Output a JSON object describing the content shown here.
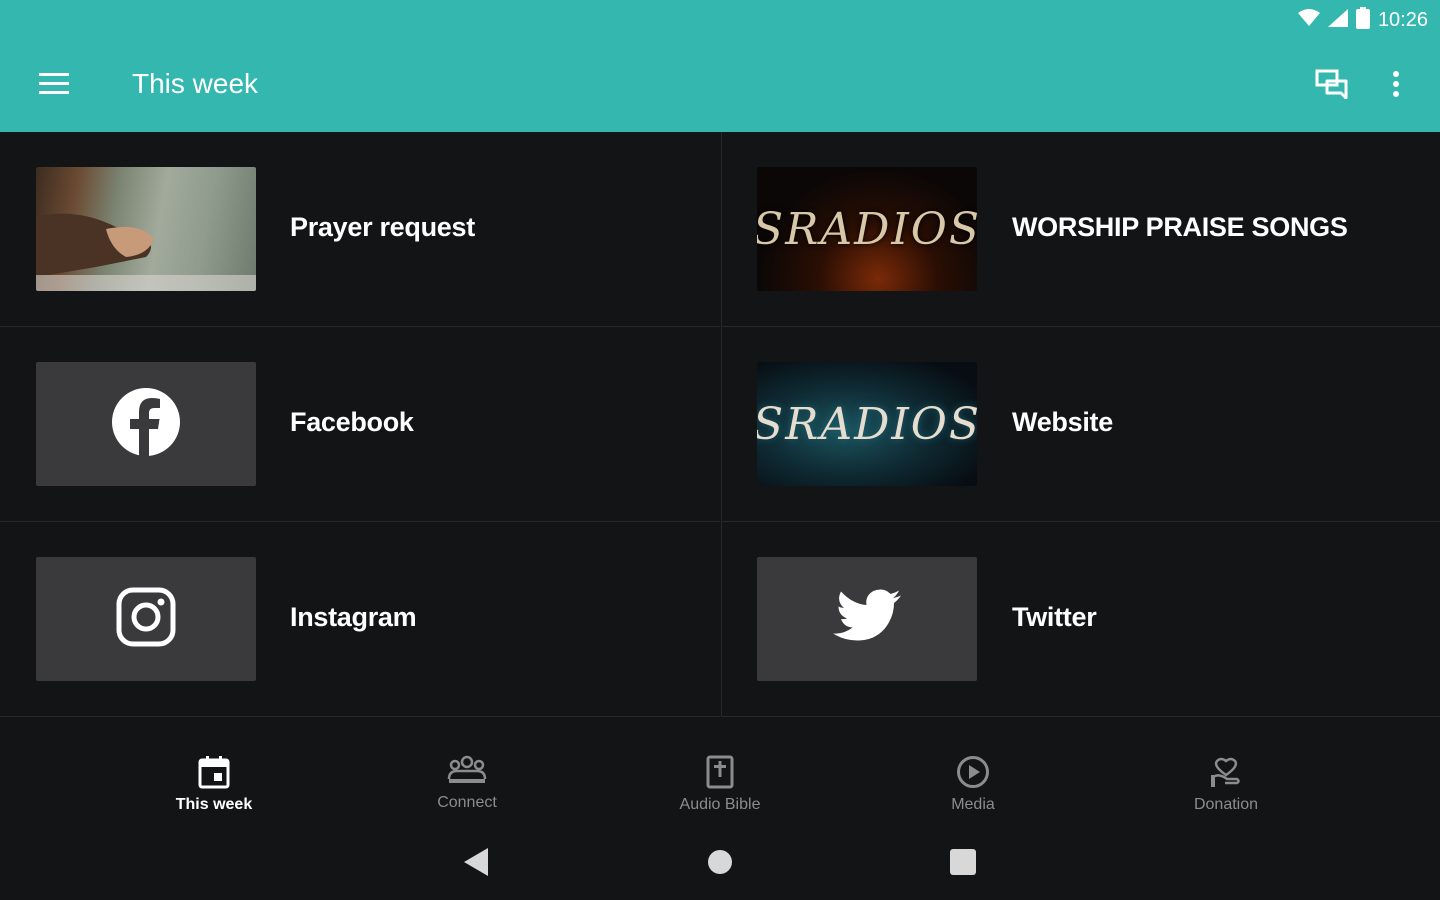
{
  "status_bar": {
    "time": "10:26",
    "icons": [
      "wifi-icon",
      "cell-signal-icon",
      "battery-icon"
    ]
  },
  "app_bar": {
    "title": "This week",
    "icons": [
      "menu-icon",
      "chat-icon",
      "more-vert-icon"
    ],
    "background": "#33b7ae"
  },
  "grid": {
    "items": [
      {
        "label": "Prayer request",
        "thumb": "photo"
      },
      {
        "label": "WORSHIP PRAISE SONGS",
        "thumb": "logo",
        "logo_text": "SRADIOS"
      },
      {
        "label": "Facebook",
        "thumb": "facebook-icon"
      },
      {
        "label": "Website",
        "thumb": "logo",
        "logo_text": "SRADIOS"
      },
      {
        "label": "Instagram",
        "thumb": "instagram-icon"
      },
      {
        "label": "Twitter",
        "thumb": "twitter-icon"
      }
    ]
  },
  "bottom_nav": {
    "items": [
      {
        "label": "This week",
        "icon": "calendar-icon",
        "active": true
      },
      {
        "label": "Connect",
        "icon": "group-icon",
        "active": false
      },
      {
        "label": "Audio Bible",
        "icon": "bible-icon",
        "active": false
      },
      {
        "label": "Media",
        "icon": "play-circle-icon",
        "active": false
      },
      {
        "label": "Donation",
        "icon": "donation-icon",
        "active": false
      }
    ]
  },
  "system_nav": {
    "icons": [
      "back-icon",
      "home-icon",
      "recents-icon"
    ]
  }
}
